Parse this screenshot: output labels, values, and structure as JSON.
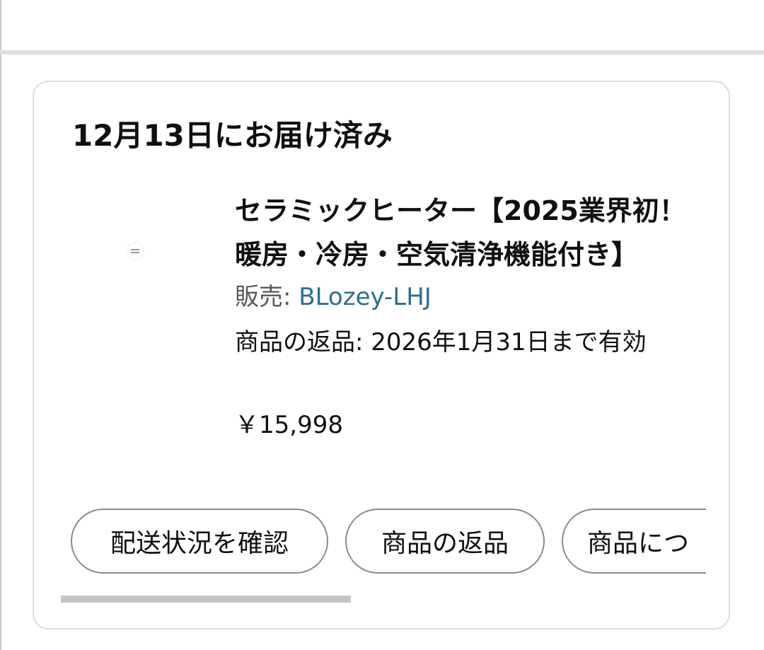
{
  "order": {
    "status": "12月13日にお届け済み",
    "product": {
      "title": "セラミックヒーター【2025業界初！暖房・冷房・空気清浄機能付き】",
      "seller_prefix": "販売: ",
      "seller_name": "BLozey-LHJ",
      "return_policy": "商品の返品: 2026年1月31日まで有効",
      "price": "￥15,998",
      "thumbnail_icon": "product-image"
    },
    "actions": [
      {
        "label": "配送状況を確認"
      },
      {
        "label": "商品の返品"
      },
      {
        "label": "商品につ"
      }
    ]
  },
  "colors": {
    "seller_link": "#2f6e8f",
    "pill_border": "#888c8c",
    "card_border": "#dadede",
    "scrollbar": "#c4c4c4"
  }
}
